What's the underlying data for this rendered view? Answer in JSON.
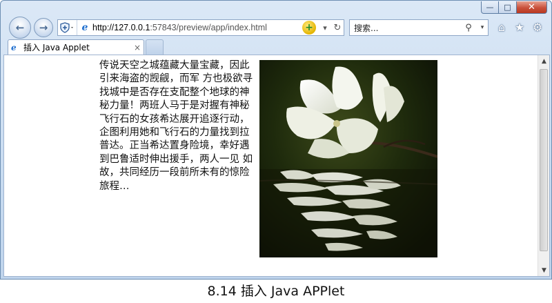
{
  "window": {
    "controls": {
      "minimize": "—",
      "maximize": "□",
      "close": "✕"
    }
  },
  "nav": {
    "back_icon": "arrow-left-icon",
    "forward_icon": "arrow-right-icon",
    "address": {
      "url_host": "http://127.0.0.1",
      "url_rest": ":57843/preview/app/index.html"
    },
    "search": {
      "placeholder": "搜索..."
    },
    "toolbar_icons": [
      "home-icon",
      "star-icon",
      "gear-icon"
    ]
  },
  "tab": {
    "label": "插入 Java Applet",
    "close": "×"
  },
  "article": {
    "text": "传说天空之城蕴藏大量宝藏，因此引来海盗的觊觎，而军 方也极欲寻找城中是否存在支配整个地球的神秘力量！两班人马于是对握有神秘飞行石的女孩希达展开追逐行动，企图利用她和飞行石的力量找到拉普达。正当希达置身险境，幸好遇到巴鲁适时伸出援手，两人一见 如故，共同经历一段前所未有的惊险旅程…"
  },
  "applet": {
    "image_subject": "white magnolia flower reflected in rippling water"
  },
  "caption": "8.14 插入 Java APPlet"
}
